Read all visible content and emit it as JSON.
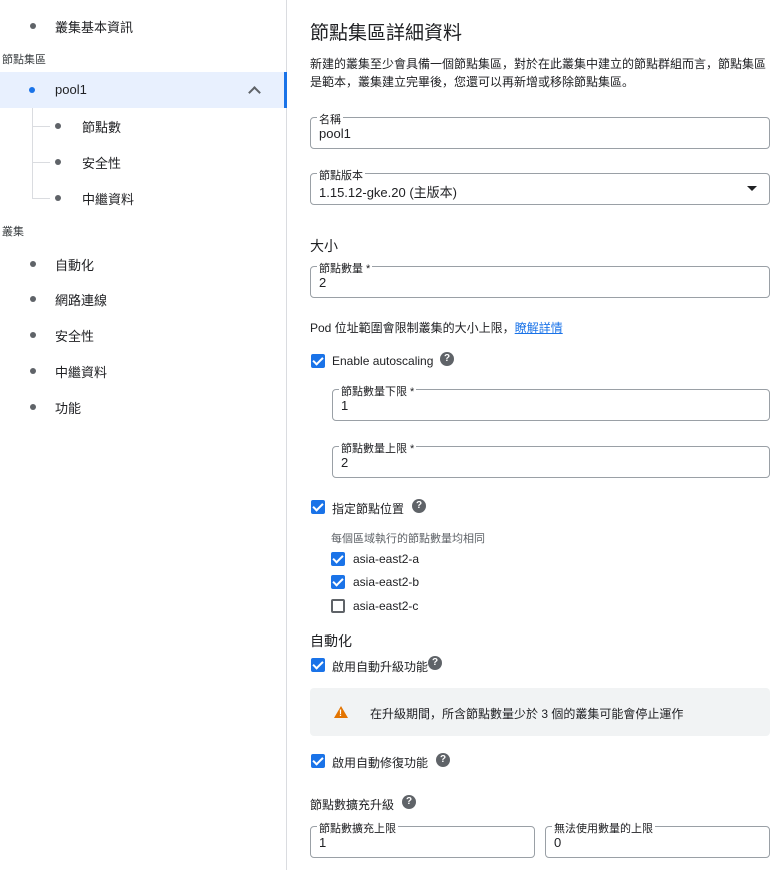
{
  "nav": {
    "cluster_basics": "叢集基本資訊",
    "node_pools_section": "節點集區",
    "pool": "pool1",
    "pool_children": [
      "節點數",
      "安全性",
      "中繼資料"
    ],
    "cluster_section": "叢集",
    "cluster_items": [
      "自動化",
      "網路連線",
      "安全性",
      "中繼資料",
      "功能"
    ]
  },
  "main": {
    "title": "節點集區詳細資料",
    "description": "新建的叢集至少會具備一個節點集區，對於在此叢集中建立的節點群組而言，節點集區是範本，叢集建立完畢後，您還可以再新增或移除節點集區。",
    "name_label": "名稱",
    "name_value": "pool1",
    "version_label": "節點版本",
    "version_value": "1.15.12-gke.20 (主版本)",
    "size_heading": "大小",
    "node_count_label": "節點數量 *",
    "node_count_value": "2",
    "pod_note": "Pod 位址範圍會限制叢集的大小上限，",
    "pod_link": "瞭解詳情",
    "autoscaling_label": "Enable autoscaling",
    "autoscaling_checked": true,
    "min_label": "節點數量下限 *",
    "min_value": "1",
    "max_label": "節點數量上限 *",
    "max_value": "2",
    "locations_label": "指定節點位置",
    "locations_checked": true,
    "zones_note": "每個區域執行的節點數量均相同",
    "zones": [
      {
        "label": "asia-east2-a",
        "checked": true
      },
      {
        "label": "asia-east2-b",
        "checked": true
      },
      {
        "label": "asia-east2-c",
        "checked": false
      }
    ],
    "automation_heading": "自動化",
    "auto_upgrade_label": "啟用自動升級功能",
    "auto_upgrade_checked": true,
    "warning_text": "在升級期間，所含節點數量少於 3 個的叢集可能會停止運作",
    "auto_repair_label": "啟用自動修復功能",
    "auto_repair_checked": true,
    "surge_heading": "節點數擴充升級",
    "max_surge_label": "節點數擴充上限",
    "max_surge_value": "1",
    "max_unavailable_label": "無法使用數量的上限",
    "max_unavailable_value": "0"
  },
  "colors": {
    "accent": "#1a73e8",
    "active_bg": "#e8f0fe",
    "warning": "#e37400"
  }
}
